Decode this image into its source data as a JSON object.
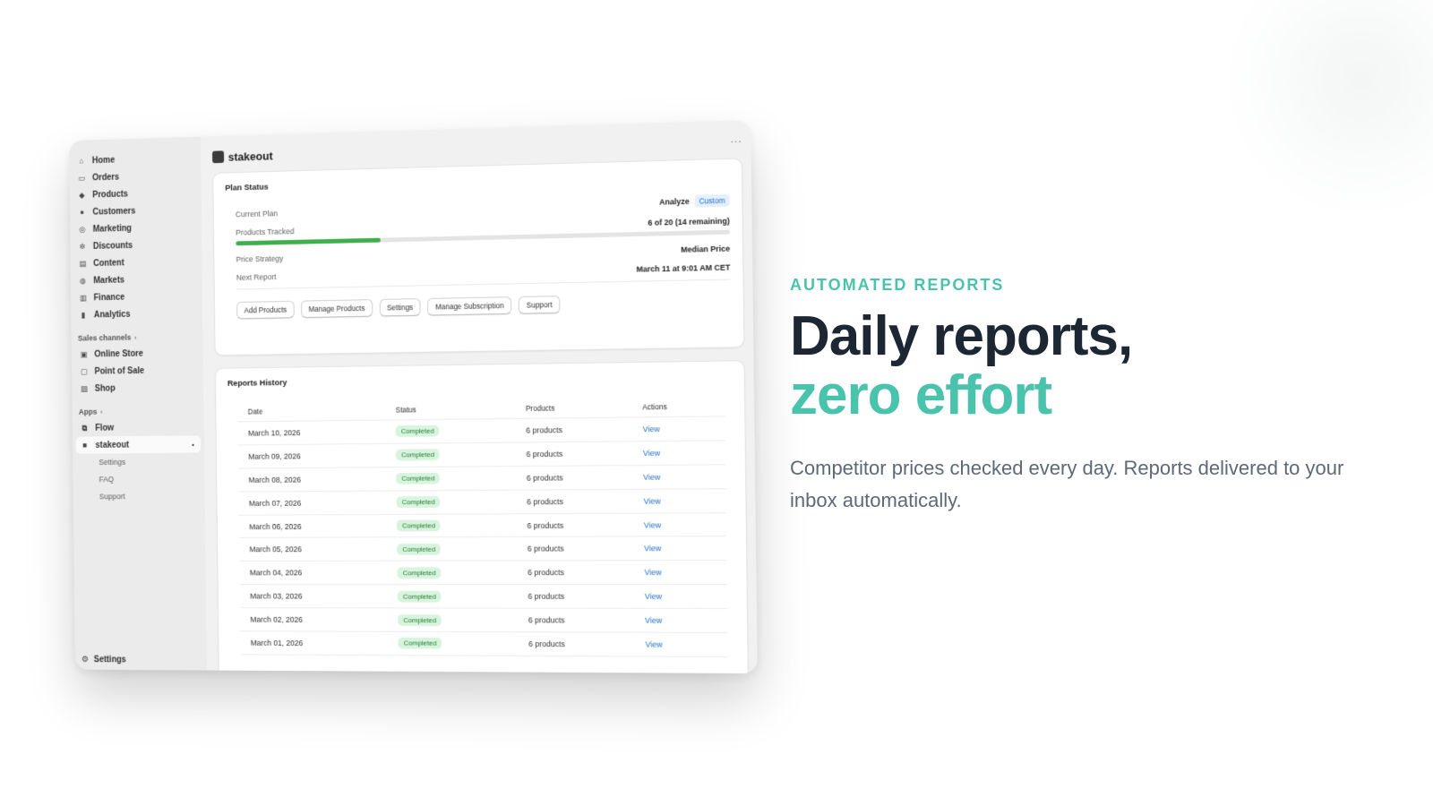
{
  "sidebar": {
    "items": [
      {
        "label": "Home",
        "icon": "home-icon",
        "glyph": "⌂"
      },
      {
        "label": "Orders",
        "icon": "inbox-icon",
        "glyph": "▭"
      },
      {
        "label": "Products",
        "icon": "tag-icon",
        "glyph": "◆"
      },
      {
        "label": "Customers",
        "icon": "person-icon",
        "glyph": "●"
      },
      {
        "label": "Marketing",
        "icon": "target-icon",
        "glyph": "◎"
      },
      {
        "label": "Discounts",
        "icon": "discount-icon",
        "glyph": "✲"
      },
      {
        "label": "Content",
        "icon": "content-icon",
        "glyph": "▤"
      },
      {
        "label": "Markets",
        "icon": "globe-icon",
        "glyph": "◍"
      },
      {
        "label": "Finance",
        "icon": "bank-icon",
        "glyph": "▥"
      },
      {
        "label": "Analytics",
        "icon": "bar-chart-icon",
        "glyph": "▮"
      }
    ],
    "sales_channels_label": "Sales channels",
    "channels": [
      {
        "label": "Online Store",
        "icon": "store-icon",
        "glyph": "▣"
      },
      {
        "label": "Point of Sale",
        "icon": "pos-icon",
        "glyph": "▢"
      },
      {
        "label": "Shop",
        "icon": "shop-icon",
        "glyph": "▧"
      }
    ],
    "apps_label": "Apps",
    "apps": [
      {
        "label": "Flow",
        "icon": "flow-icon",
        "glyph": "⧉"
      },
      {
        "label": "stakeout",
        "icon": "stakeout-icon",
        "glyph": "■"
      }
    ],
    "stakeout_sub": [
      "Settings",
      "FAQ",
      "Support"
    ],
    "footer_settings": "Settings"
  },
  "app": {
    "name": "stakeout"
  },
  "plan": {
    "title": "Plan Status",
    "current_plan_label": "Current Plan",
    "current_plan_value": "Analyze",
    "plan_badge": "Custom",
    "products_tracked_label": "Products Tracked",
    "products_tracked_value": "6 of 20 (14 remaining)",
    "progress_fraction": 0.3,
    "price_strategy_label": "Price Strategy",
    "price_strategy_value": "Median Price",
    "next_report_label": "Next Report",
    "next_report_value": "March 11 at 9:01 AM CET",
    "buttons": [
      "Add Products",
      "Manage Products",
      "Settings",
      "Manage Subscription",
      "Support"
    ]
  },
  "reports": {
    "title": "Reports History",
    "columns": [
      "Date",
      "Status",
      "Products",
      "Actions"
    ],
    "rows": [
      {
        "date": "March 10, 2026",
        "status": "Completed",
        "products": "6 products",
        "action": "View"
      },
      {
        "date": "March 09, 2026",
        "status": "Completed",
        "products": "6 products",
        "action": "View"
      },
      {
        "date": "March 08, 2026",
        "status": "Completed",
        "products": "6 products",
        "action": "View"
      },
      {
        "date": "March 07, 2026",
        "status": "Completed",
        "products": "6 products",
        "action": "View"
      },
      {
        "date": "March 06, 2026",
        "status": "Completed",
        "products": "6 products",
        "action": "View"
      },
      {
        "date": "March 05, 2026",
        "status": "Completed",
        "products": "6 products",
        "action": "View"
      },
      {
        "date": "March 04, 2026",
        "status": "Completed",
        "products": "6 products",
        "action": "View"
      },
      {
        "date": "March 03, 2026",
        "status": "Completed",
        "products": "6 products",
        "action": "View"
      },
      {
        "date": "March 02, 2026",
        "status": "Completed",
        "products": "6 products",
        "action": "View"
      },
      {
        "date": "March 01, 2026",
        "status": "Completed",
        "products": "6 products",
        "action": "View"
      }
    ]
  },
  "marketing": {
    "eyebrow": "AUTOMATED REPORTS",
    "headline_line1": "Daily reports,",
    "headline_line2": "zero effort",
    "subtext": "Competitor prices checked every day. Reports delivered to your inbox automatically."
  },
  "colors": {
    "accent": "#4ac3ad",
    "headline": "#1d2633",
    "progress_fill": "#3fae4d",
    "link": "#1f6fc5"
  }
}
